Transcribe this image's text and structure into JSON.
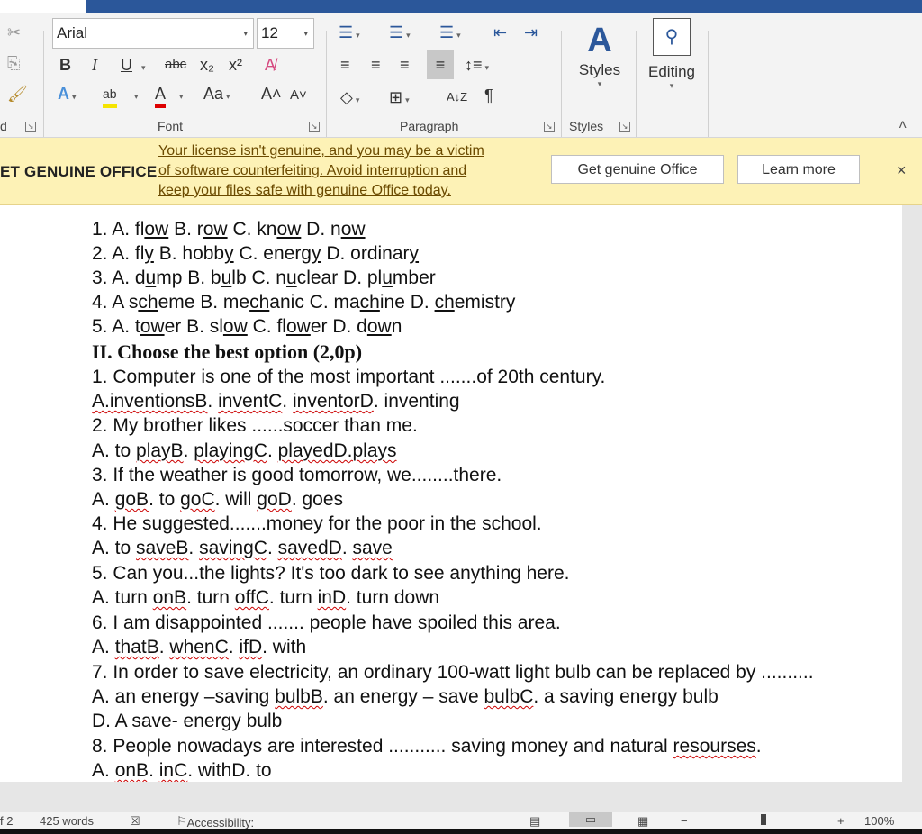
{
  "ribbon": {
    "font_name": "Arial",
    "font_size": "12",
    "bold": "B",
    "italic": "I",
    "underline": "U",
    "strike": "abc",
    "subscript": "x₂",
    "superscript": "x²",
    "change_case": "Aa",
    "grow": "A˄",
    "shrink": "A˅",
    "pilcrow": "¶",
    "sort": "A↓Z",
    "styles_label": "Styles",
    "editing_label": "Editing",
    "groups": {
      "clipboard_fragment": "d",
      "font": "Font",
      "paragraph": "Paragraph",
      "styles": "Styles"
    }
  },
  "notice": {
    "title": "ET GENUINE OFFICE",
    "message_lines": [
      "Your license isn't genuine, and you may be a victim",
      "of software counterfeiting. Avoid interruption and",
      "keep your files safe with genuine Office today."
    ],
    "get_genuine": "Get genuine Office",
    "learn_more": "Learn more",
    "close": "×"
  },
  "doc": {
    "lines": [
      [
        "1. A. fl",
        "ow",
        " B. r",
        "ow",
        " C. kn",
        "ow",
        " D. n",
        "ow",
        ""
      ],
      [
        "2. A. fl",
        "y",
        " B. hobb",
        "y",
        " C. energ",
        "y",
        " D. ordinar",
        "y",
        ""
      ],
      [
        "3. A. d",
        "u",
        "mp B. b",
        "u",
        "lb C. n",
        "u",
        "clear D. pl",
        "u",
        "mber"
      ],
      [
        "4. A s",
        "ch",
        "eme B. me",
        "ch",
        "anic C. ma",
        "ch",
        "ine D. ",
        "ch",
        "emistry"
      ],
      [
        "5. A. t",
        "ow",
        "er B. sl",
        "ow",
        " C. fl",
        "ow",
        "er D. d",
        "ow",
        "n"
      ]
    ],
    "heading": "II. Choose the best option (2,0p)",
    "q1": "1. Computer is one of the most important .......of 20th century.",
    "a1": [
      "A.inventionsB",
      ". ",
      "inventC",
      ". ",
      "inventorD",
      ". inventing"
    ],
    "q2": "2. My brother likes ......soccer than me.",
    "a2": [
      "A. to ",
      "playB",
      ". ",
      "playingC",
      ". ",
      "playedD.plays",
      ""
    ],
    "q3": "3. If the weather is good tomorrow, we........there.",
    "a3": [
      "A. ",
      "goB",
      ". to ",
      "goC",
      ". will ",
      "goD",
      ". goes"
    ],
    "q4": "4. He suggested.......money for the poor in the school.",
    "a4": [
      "A. to ",
      "saveB",
      ". ",
      "savingC",
      ". ",
      "savedD",
      ". ",
      "save"
    ],
    "q5": "5. Can you...the lights? It's too dark to see anything here.",
    "a5": [
      "A. turn ",
      "onB",
      ". turn ",
      "offC",
      ". turn ",
      "inD",
      ". turn down"
    ],
    "q6": "6. I am disappointed ....... people have spoiled this area.",
    "a6": [
      "A. ",
      "thatB",
      ". ",
      "whenC",
      ". ",
      "ifD",
      ". with"
    ],
    "q7": "7. In order to save electricity, an ordinary 100-watt light bulb can be replaced by ..........",
    "a7": [
      "A. an energy –saving ",
      "bulbB",
      ". an energy – save ",
      "bulbC",
      ". a saving energy bulb"
    ],
    "a7d": "D. A save- energy bulb",
    "q8": [
      "8. People nowadays are interested ........... saving money and natural ",
      "resourses",
      "."
    ],
    "a8": [
      "A. ",
      "onB",
      ". ",
      "inC",
      ". withD. to"
    ]
  },
  "status": {
    "page": "f 2",
    "words": "425 words",
    "accessibility": "Accessibility: Good to go",
    "zoom": "100%"
  }
}
